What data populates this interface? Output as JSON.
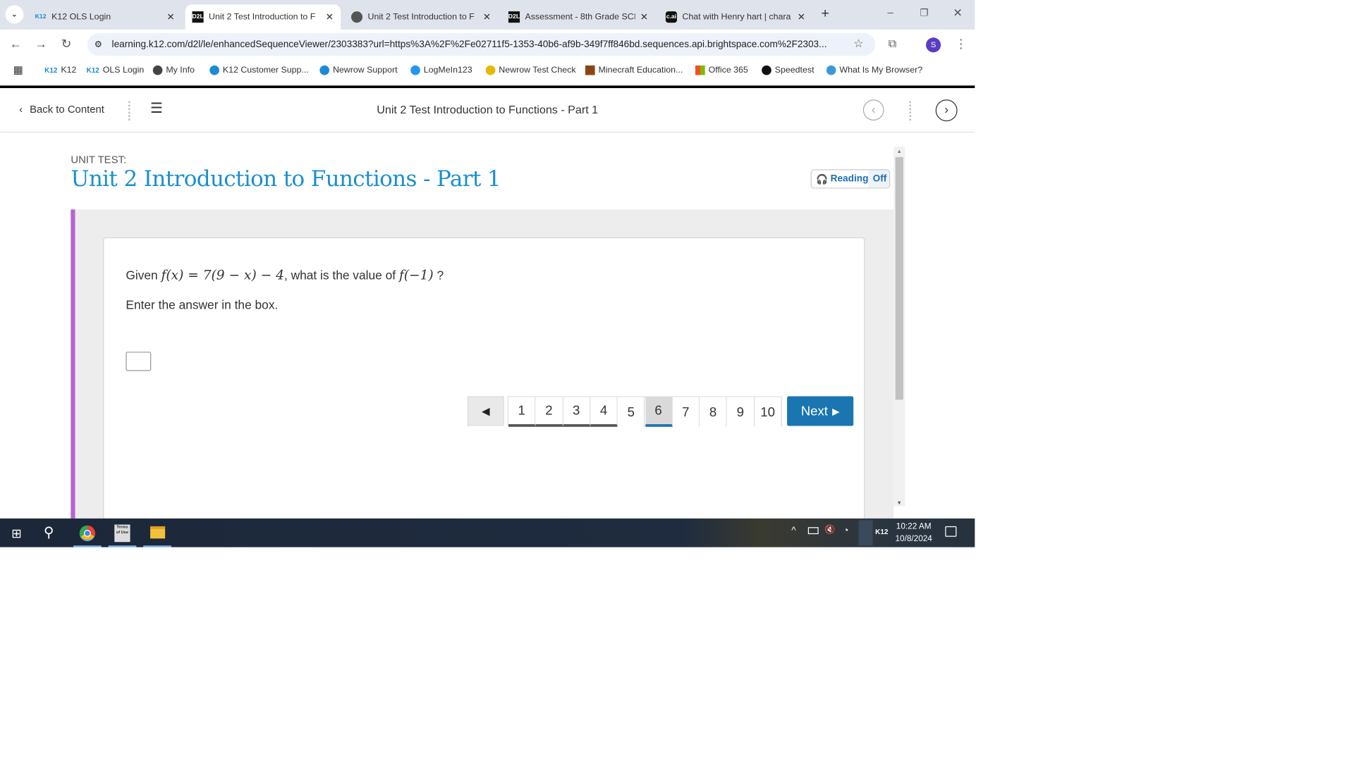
{
  "browser": {
    "tabs": [
      {
        "label": "K12 OLS Login",
        "favicon": "K12"
      },
      {
        "label": "Unit 2 Test Introduction to F",
        "favicon": "D2L",
        "active": true
      },
      {
        "label": "Unit 2 Test Introduction to F",
        "favicon": "globe-icon"
      },
      {
        "label": "Assessment - 8th Grade SCIE",
        "favicon": "D2L"
      },
      {
        "label": "Chat with Henry hart | chara",
        "favicon": "c.ai"
      }
    ],
    "url": "learning.k12.com/d2l/le/enhancedSequenceViewer/2303383?url=https%3A%2F%2Fe02711f5-1353-40b6-af9b-349f7ff846bd.sequences.api.brightspace.com%2F2303...",
    "profile_initial": "S",
    "bookmarks": [
      {
        "label": "K12",
        "icon": "K12"
      },
      {
        "label": "OLS Login",
        "icon": "K12"
      },
      {
        "label": "My Info",
        "color": "#333"
      },
      {
        "label": "K12 Customer Supp...",
        "color": "#1a8ad4"
      },
      {
        "label": "Newrow Support",
        "color": "#1a8ad4"
      },
      {
        "label": "LogMeIn123",
        "color": "#2196f3"
      },
      {
        "label": "Newrow Test Check",
        "color": "#e6b800"
      },
      {
        "label": "Minecraft Education...",
        "color": "#8b4513"
      },
      {
        "label": "Office 365",
        "color": "#f25022"
      },
      {
        "label": "Speedtest",
        "color": "#111"
      },
      {
        "label": "What Is My Browser?",
        "color": "#3a9ad9"
      }
    ]
  },
  "header": {
    "back_label": "Back to Content",
    "title": "Unit 2 Test Introduction to Functions - Part 1"
  },
  "page": {
    "eyebrow": "UNIT TEST:",
    "title": "Unit 2 Introduction to Functions - Part 1",
    "reading_label": "Reading",
    "reading_state": "Off",
    "question_prefix": "Given ",
    "question_math": "f(x) = 7(9 − x) − 4",
    "question_mid": ", what is the value of ",
    "question_math2": "f(−1)",
    "question_suffix": " ?",
    "instruction": "Enter the answer in the box.",
    "answer_value": ""
  },
  "pagination": {
    "pages": [
      "1",
      "2",
      "3",
      "4",
      "5",
      "6",
      "7",
      "8",
      "9",
      "10"
    ],
    "current": "6",
    "answered": [
      "1",
      "2",
      "3",
      "4"
    ],
    "next_label": "Next"
  },
  "colors": {
    "accent": "#1a75b0",
    "title": "#1a8fcf",
    "stripe": "#b565cf"
  },
  "taskbar": {
    "time": "10:22 AM",
    "date": "10/8/2024",
    "tray_label": "K12",
    "terms_icon_text": "Terms of Use"
  }
}
